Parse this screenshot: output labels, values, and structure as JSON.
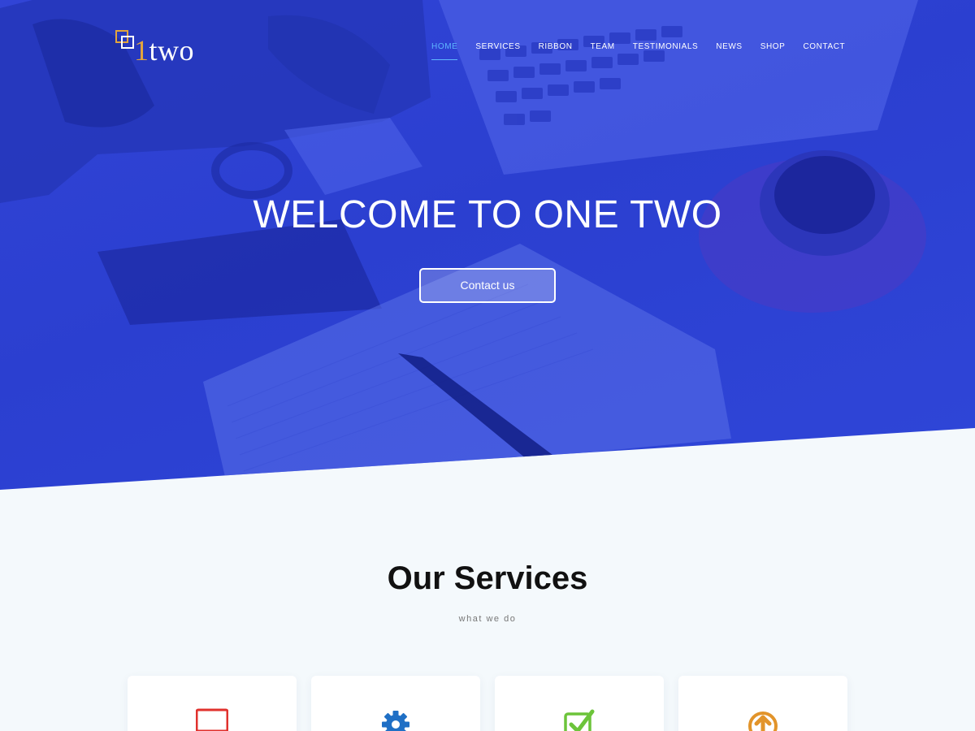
{
  "brand": {
    "logo_one": "1",
    "logo_two": "two",
    "accent": "#e2a43d"
  },
  "nav": {
    "items": [
      {
        "label": "HOME",
        "active": true
      },
      {
        "label": "SERVICES"
      },
      {
        "label": "RIBBON"
      },
      {
        "label": "TEAM"
      },
      {
        "label": "TESTIMONIALS"
      },
      {
        "label": "NEWS"
      },
      {
        "label": "SHOP"
      },
      {
        "label": "CONTACT"
      }
    ],
    "active_color": "#5fb7ff"
  },
  "hero": {
    "title": "WELCOME TO ONE TWO",
    "button_label": "Contact us",
    "overlay_color": "#2b3fd0"
  },
  "services": {
    "title": "Our Services",
    "subtitle": "what we do",
    "cards": [
      {
        "icon": "laptop-icon",
        "color": "#e0312d"
      },
      {
        "icon": "gear-icon",
        "color": "#1f6fc5"
      },
      {
        "icon": "checkbox-icon",
        "color": "#6cc43a"
      },
      {
        "icon": "upload-icon",
        "color": "#e2942a"
      }
    ]
  }
}
